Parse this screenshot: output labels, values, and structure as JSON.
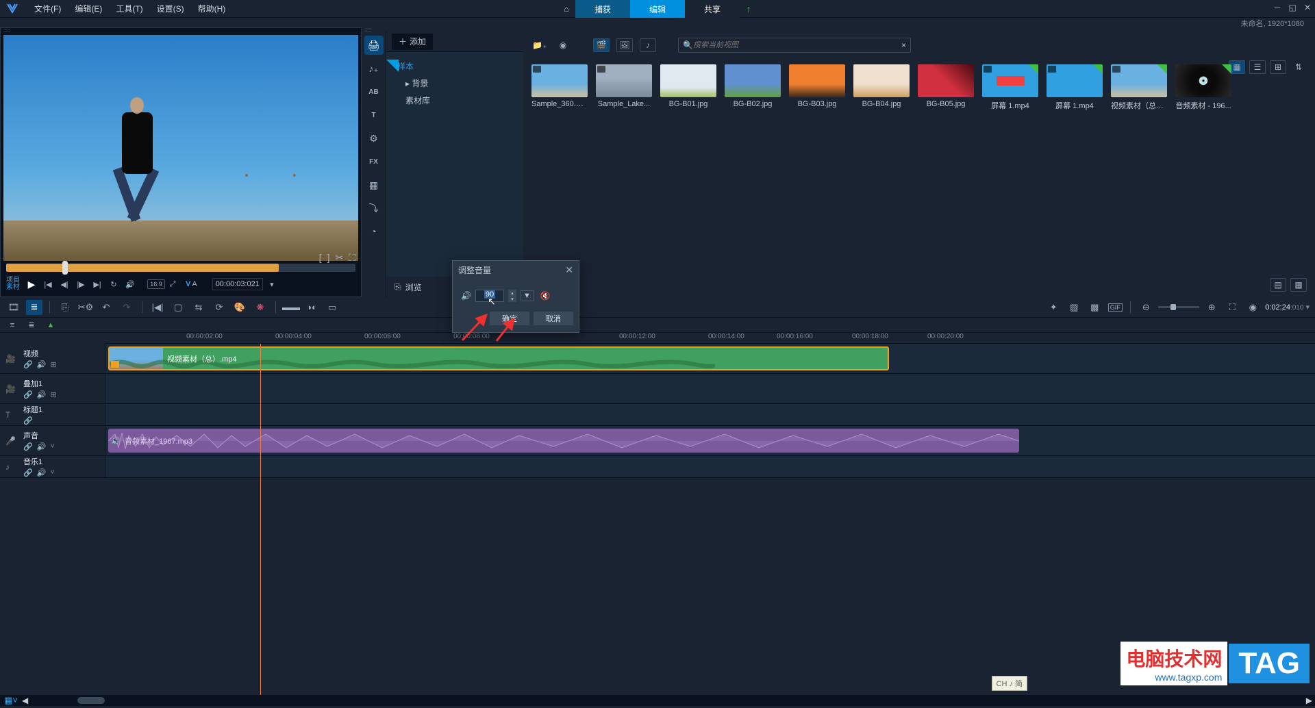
{
  "menu": {
    "file": "文件(F)",
    "edit": "编辑(E)",
    "tools": "工具(T)",
    "settings": "设置(S)",
    "help": "帮助(H)"
  },
  "top_tabs": {
    "capture": "捕获",
    "edit": "编辑",
    "share": "共享"
  },
  "project_info": "未命名, 1920*1080",
  "preview": {
    "project_label": "项目",
    "material_label": "素材",
    "aspect_ratio": "16:9",
    "timecode": "00:00:03:021"
  },
  "library": {
    "add_label": "添加",
    "tree": {
      "sample": "样本",
      "background": "背景",
      "material_lib": "素材库"
    },
    "search_placeholder": "搜索当前视图",
    "browse_label": "浏览",
    "media": [
      {
        "name": "Sample_360.m..."
      },
      {
        "name": "Sample_Lake..."
      },
      {
        "name": "BG-B01.jpg"
      },
      {
        "name": "BG-B02.jpg"
      },
      {
        "name": "BG-B03.jpg"
      },
      {
        "name": "BG-B04.jpg"
      },
      {
        "name": "BG-B05.jpg"
      },
      {
        "name": "屏幕 1.mp4"
      },
      {
        "name": "屏幕 1.mp4"
      },
      {
        "name": "视频素材（总）..."
      },
      {
        "name": "音频素材 - 196..."
      }
    ]
  },
  "timeline": {
    "duration": "0:02:24",
    "duration_frames": ":010",
    "ruler": [
      {
        "label": "00:00:02:00",
        "pos": 118
      },
      {
        "label": "00:00:04:00",
        "pos": 248
      },
      {
        "label": "00:00:06:00",
        "pos": 378
      },
      {
        "label": "00:00:08:00",
        "pos": 508
      },
      {
        "label": "00:00:12:00",
        "pos": 750
      },
      {
        "label": "00:00:14:00",
        "pos": 880
      },
      {
        "label": "00:00:16:00",
        "pos": 980
      },
      {
        "label": "00:00:18:00",
        "pos": 1090
      },
      {
        "label": "00:00:20:00",
        "pos": 1200
      }
    ],
    "tracks": {
      "video": "视频",
      "overlay1": "叠加1",
      "title1": "标题1",
      "voice": "声音",
      "music1": "音乐1"
    },
    "clips": {
      "video_name": "视频素材（总）.mp4",
      "audio_name": "音频素材_1967.mp3"
    }
  },
  "modal": {
    "title": "调整音量",
    "value": "90",
    "ok": "确定",
    "cancel": "取消"
  },
  "ime": "CH ♪ 简",
  "watermark": {
    "cn": "电脑技术网",
    "url": "www.tagxp.com",
    "tag": "TAG"
  }
}
